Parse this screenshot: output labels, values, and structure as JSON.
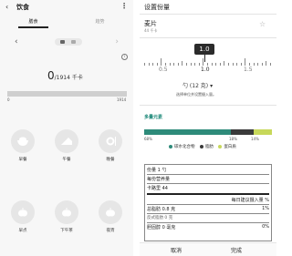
{
  "left": {
    "title": "饮食",
    "tabs": [
      "膳食",
      "趋势"
    ],
    "calories": {
      "consumed": "0",
      "goal_text": "/1914 千卡",
      "bar_min": "0",
      "bar_max": "1914",
      "progress": 0
    },
    "meals": [
      {
        "label": "早餐",
        "icon": "rice-bowl-icon"
      },
      {
        "label": "午餐",
        "icon": "cake-slice-icon"
      },
      {
        "label": "晚餐",
        "icon": "plate-icon"
      },
      {
        "label": "早点",
        "icon": "apple-icon"
      },
      {
        "label": "下午茶",
        "icon": "apple-icon"
      },
      {
        "label": "夜宵",
        "icon": "apple-icon"
      }
    ]
  },
  "right": {
    "title": "设置份量",
    "food_name": "麦片",
    "food_sub": "44 千卡",
    "selected_value": "1.0",
    "ruler_labels": [
      "0.5",
      "1.0",
      "1.5"
    ],
    "unit": "勺 (12 克)",
    "unit_hint": "选择单位并设置摄入量。",
    "section_title": "多量元素",
    "macros": [
      {
        "name": "碳水化合物",
        "pct": "68%",
        "fraction": 0.68,
        "color": "#2e8b7a"
      },
      {
        "name": "脂肪",
        "pct": "18%",
        "fraction": 0.18,
        "color": "#3a3a3a"
      },
      {
        "name": "蛋白质",
        "pct": "14%",
        "fraction": 0.14,
        "color": "#c7d85a"
      }
    ],
    "nutrition": {
      "serving": "份量 1 勺",
      "per_serving": "每份营养量",
      "calories": "卡路里 44",
      "daily_header": "每日建议摄入量 %",
      "fat": "总脂肪 0.8 克",
      "fat_pct": "1%",
      "sat_fat": "反式脂肪 0 克",
      "chol": "胆固醇 0 毫克",
      "chol_pct": "0%"
    },
    "cancel_label": "取消",
    "done_label": "完成"
  }
}
